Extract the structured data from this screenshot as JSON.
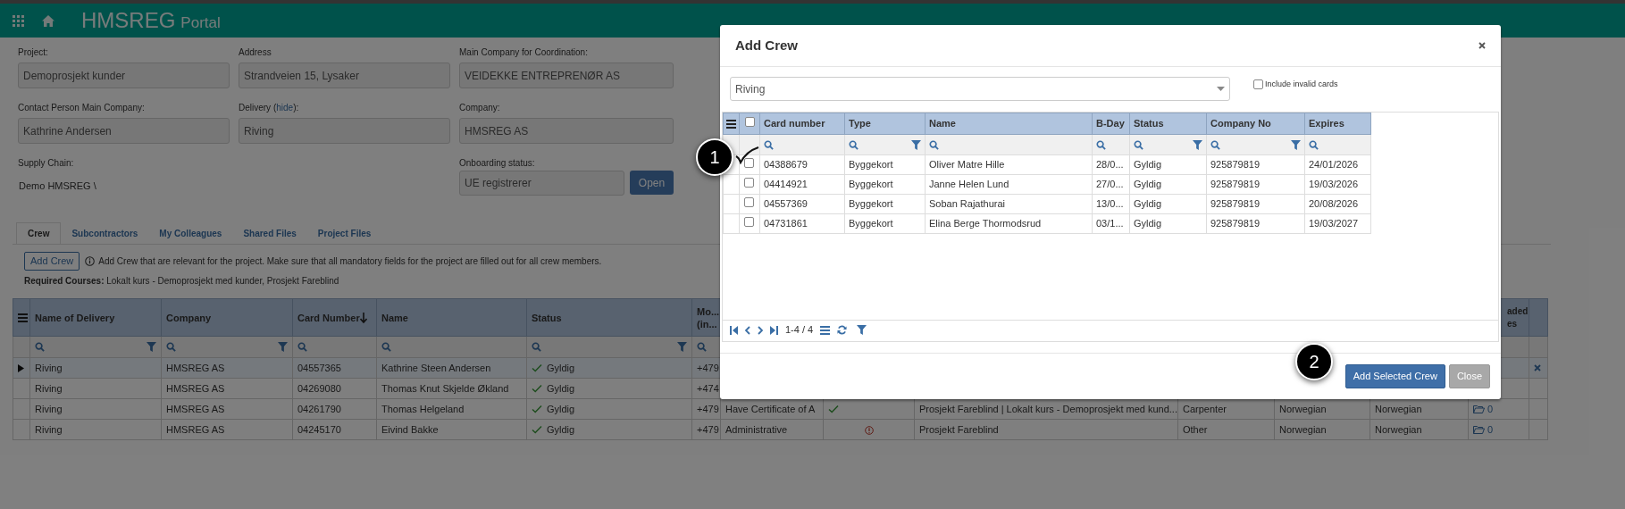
{
  "header": {
    "brand": "HMSREG",
    "product": "Portal"
  },
  "fields": [
    {
      "kind": "input",
      "label": "Project:",
      "value": "Demoprosjekt kunder"
    },
    {
      "kind": "input",
      "label": "Address",
      "value": "Strandveien 15, Lysaker"
    },
    {
      "kind": "input",
      "label": "Main Company for Coordination:",
      "value": "VEIDEKKE ENTREPRENØR AS"
    },
    {
      "kind": "input",
      "label": "Contact Person Main Company:",
      "value": "Kathrine Andersen"
    },
    {
      "kind": "input",
      "label": "Delivery (",
      "link": "hide",
      "label_end": "):",
      "value": "Riving"
    },
    {
      "kind": "input",
      "label": "Company:",
      "value": "HMSREG AS"
    },
    {
      "kind": "text",
      "label": "Supply Chain:",
      "value": "Demo HMSREG \\"
    },
    {
      "kind": "empty"
    },
    {
      "kind": "action",
      "label": "Onboarding status:",
      "value": "UE registrerer",
      "button": "Open"
    }
  ],
  "tabs": [
    {
      "label": "Crew",
      "selected": true
    },
    {
      "label": "Subcontractors",
      "selected": false
    },
    {
      "label": "My Colleagues",
      "selected": false
    },
    {
      "label": "Shared Files",
      "selected": false
    },
    {
      "label": "Project Files",
      "selected": false
    }
  ],
  "crew_panel": {
    "add_button": "Add Crew",
    "info": "Add Crew that are relevant for the project. Make sure that all mandatory fields for the project are filled out for all crew members.",
    "required": "**Required Courses:** Lokalt kurs - Demoprosjekt med kunder, Prosjekt Fareblind"
  },
  "table": {
    "columns": [
      {
        "label": "Name of Delivery",
        "filter": true
      },
      {
        "label": "Company",
        "filter": true
      },
      {
        "label": "Card Number",
        "filter": false,
        "sorted_descending": true
      },
      {
        "label": "Name",
        "filter": false
      },
      {
        "label": "Status",
        "filter": true
      },
      {
        "label": "Mo... (in...",
        "filter": false
      },
      {
        "label": "aded es"
      }
    ],
    "rows": [
      {
        "selected": true,
        "delivery": "Riving",
        "company": "HMSREG AS",
        "card": "04557365",
        "name": "Kathrine Steen Andersen",
        "status": "Gyldig",
        "mobile": "+479"
      },
      {
        "selected": false,
        "delivery": "Riving",
        "company": "HMSREG AS",
        "card": "04269080",
        "name": "Thomas Knut Skjelde Økland",
        "status": "Gyldig",
        "mobile": "+474"
      },
      {
        "selected": false,
        "delivery": "Riving",
        "company": "HMSREG AS",
        "card": "04261790",
        "name": "Thomas Helgeland",
        "status": "Gyldig",
        "mobile": "+479",
        "certificate": "Have Certificate of A",
        "cert_ok": true,
        "courses": "Prosjekt Fareblind | Lokalt kurs - Demoprosjekt med kund...",
        "role": "Carpenter",
        "language_1": "Norwegian",
        "language_2": "Norwegian",
        "files": "0"
      },
      {
        "selected": false,
        "delivery": "Riving",
        "company": "HMSREG AS",
        "card": "04245170",
        "name": "Eivind Bakke",
        "status": "Gyldig",
        "mobile": "+479",
        "certificate": "Administrative",
        "cert_ok": false,
        "courses": "Prosjekt Fareblind",
        "role": "Other",
        "language_1": "Norwegian",
        "language_2": "Norwegian",
        "files": "0"
      }
    ]
  },
  "modal": {
    "title": "Add Crew",
    "delivery_select": "Riving",
    "include_invalid": {
      "label": "Include invalid cards",
      "checked": false
    },
    "select_all_checked": false,
    "columns": [
      {
        "label": "Card number",
        "filter": false
      },
      {
        "label": "Type",
        "filter": true
      },
      {
        "label": "Name",
        "filter": false
      },
      {
        "label": "B-Day",
        "filter": false
      },
      {
        "label": "Status",
        "filter": true
      },
      {
        "label": "Company No",
        "filter": true
      },
      {
        "label": "Expires",
        "filter": false
      }
    ],
    "rows": [
      {
        "checked": false,
        "cells": [
          "04388679",
          "Byggekort",
          "Oliver Matre Hille",
          "28/0...",
          "Gyldig",
          "925879819",
          "24/01/2026"
        ]
      },
      {
        "checked": false,
        "cells": [
          "04414921",
          "Byggekort",
          "Janne Helen Lund",
          "27/0...",
          "Gyldig",
          "925879819",
          "19/03/2026"
        ]
      },
      {
        "checked": false,
        "cells": [
          "04557369",
          "Byggekort",
          "Soban Rajathurai",
          "13/0...",
          "Gyldig",
          "925879819",
          "20/08/2026"
        ]
      },
      {
        "checked": false,
        "cells": [
          "04731861",
          "Byggekort",
          "Elina Berge Thormodsrud",
          "03/1...",
          "Gyldig",
          "925879819",
          "19/03/2027"
        ]
      }
    ],
    "pager": "1-4 / 4",
    "buttons": [
      {
        "kind": "primary",
        "label": "Add Selected Crew"
      },
      {
        "kind": "secondary",
        "label": "Close"
      }
    ]
  },
  "callouts": [
    {
      "label": "1"
    },
    {
      "label": "2"
    }
  ]
}
